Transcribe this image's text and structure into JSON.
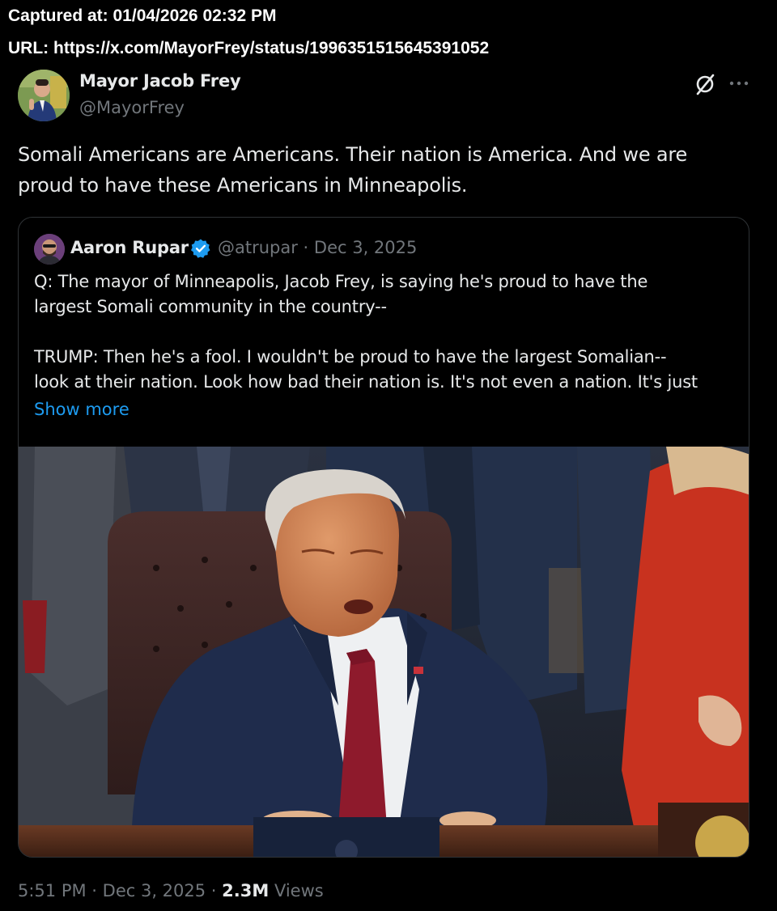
{
  "capture": {
    "captured_at": "Captured at: 01/04/2026 02:32 PM",
    "url": "URL: https://x.com/MayorFrey/status/1996351515645391052"
  },
  "tweet": {
    "author_name": "Mayor Jacob Frey",
    "author_handle": "@MayorFrey",
    "text_line1": "Somali Americans are Americans. Their nation is America. And we are",
    "text_line2": "proud to have these Americans in Minneapolis.",
    "icons": [
      "grok-icon",
      "more-icon"
    ]
  },
  "quoted_tweet": {
    "author_name": "Aaron Rupar",
    "verified": true,
    "handle_and_date": "@atrupar · Dec 3, 2025",
    "text_lines": [
      "Q: The mayor of Minneapolis, Jacob Frey, is saying he's proud to have the",
      "largest Somali community in the country--",
      "TRUMP: Then he's a fool. I wouldn't be proud to have the largest Somalian--",
      "look at their nation. Look how bad their nation is. It's not even a nation. It's just"
    ],
    "show_more": "Show more",
    "media": "video-still"
  },
  "footer": {
    "time": "5:51 PM",
    "separator1": " · ",
    "date": "Dec 3, 2025",
    "separator2": " · ",
    "views_count": "2.3M",
    "views_label": " Views"
  },
  "colors": {
    "background": "#000000",
    "text_primary": "#e7e9ea",
    "text_secondary": "#71767b",
    "link": "#1d9bf0",
    "verified": "#1d9bf0",
    "border": "#2f3336"
  }
}
